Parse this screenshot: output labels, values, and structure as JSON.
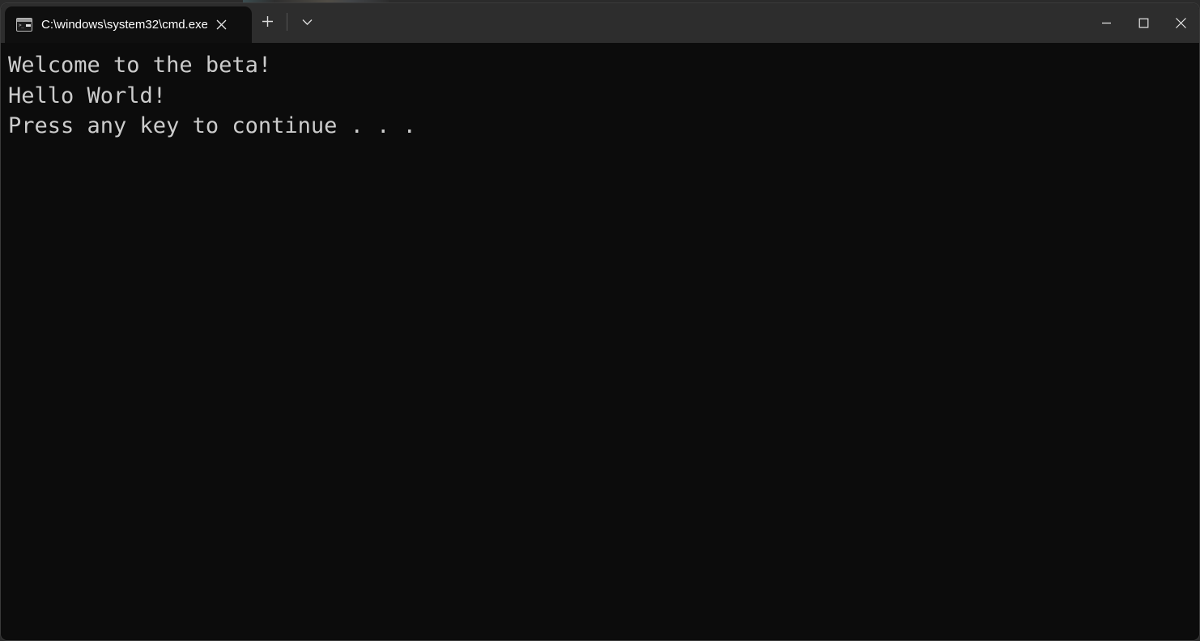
{
  "window": {
    "tab": {
      "icon": "console-window-icon",
      "title": "C:\\windows\\system32\\cmd.exe",
      "close_label": "close-tab-icon"
    },
    "tab_actions": {
      "new_tab_label": "new-tab-icon",
      "dropdown_label": "chevron-down-icon"
    },
    "caption": {
      "minimize_label": "minimize-icon",
      "maximize_label": "maximize-icon",
      "close_label": "close-icon"
    },
    "colors": {
      "titlebar_bg": "#2d2d2d",
      "tab_bg": "#0f0f0f",
      "terminal_bg": "#0c0c0c",
      "terminal_fg": "#cccccc",
      "tab_title_fg": "#ffffff",
      "window_border": "#3a3a3a"
    }
  },
  "terminal": {
    "lines": [
      "Welcome to the beta!",
      "Hello World!",
      "Press any key to continue . . ."
    ],
    "line_1": "Welcome to the beta!",
    "line_2": "Hello World!",
    "line_3": "Press any key to continue . . ."
  }
}
